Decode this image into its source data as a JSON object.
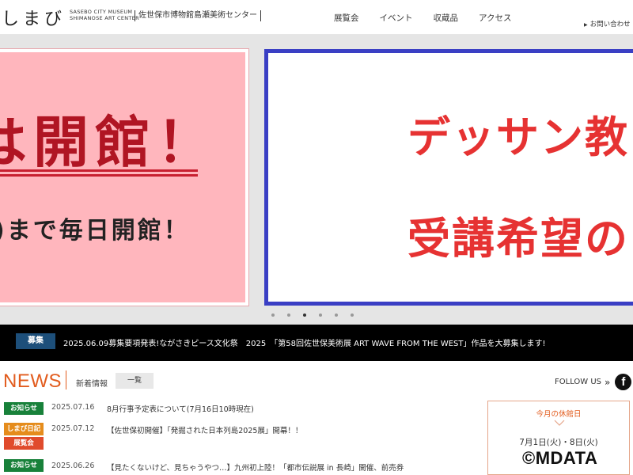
{
  "header": {
    "logo": "しまび",
    "logo_en_line1": "SASEBO CITY MUSEUM",
    "logo_en_line2": "SHIMANOSE ART CENTER",
    "logo_jp": "佐世保市博物館島瀬美術センター",
    "nav": [
      "展覧会",
      "イベント",
      "収蔵品",
      "アクセス"
    ],
    "contact": "お問い合わせ",
    "contact_icon": "triangle-right-icon"
  },
  "hero": {
    "pink_title": "は開館！",
    "pink_sub": ")まで毎日開館！",
    "blue_title": "デッサン教",
    "blue_sub": "受講希望の",
    "colors": {
      "pink_bg": "#ffb6bd",
      "pink_text": "#b01523",
      "blue_border": "#3a3fc4",
      "red_text": "#e63232"
    },
    "carousel": {
      "count": 6,
      "active_index": 2
    }
  },
  "ticker": {
    "badge": "募集",
    "text": "2025.06.09募集要項発表!ながさきピース文化祭　2025　「第58回佐世保美術展 ART WAVE FROM THE WEST」作品を大募集します!"
  },
  "news": {
    "title": "NEWS",
    "subtitle": "新着情報",
    "all_button": "一覧",
    "follow": "FOLLOW US",
    "follow_icons": [
      "chevrons-right-icon",
      "facebook-icon"
    ],
    "items": [
      {
        "tags": [
          {
            "label": "お知らせ",
            "color": "green"
          }
        ],
        "date": "2025.07.16",
        "text": "8月行事予定表について(7月16日10時現在)"
      },
      {
        "tags": [
          {
            "label": "しまび日記",
            "color": "orange"
          },
          {
            "label": "展覧会",
            "color": "red"
          }
        ],
        "date": "2025.07.12",
        "text": "【佐世保初開催】「発掘された日本列島2025展」開幕！！"
      },
      {
        "tags": [
          {
            "label": "お知らせ",
            "color": "green"
          }
        ],
        "date": "2025.06.26",
        "text": "【見たくないけど、見ちゃうやつ…】九州初上陸！「都市伝説展 in 長崎」開催、前売券"
      }
    ],
    "closed_days": {
      "title": "今月の休館日",
      "dates": "7月1日(火)・8日(火)",
      "icon": "chevron-down-icon"
    }
  },
  "watermark": "©MDATA"
}
